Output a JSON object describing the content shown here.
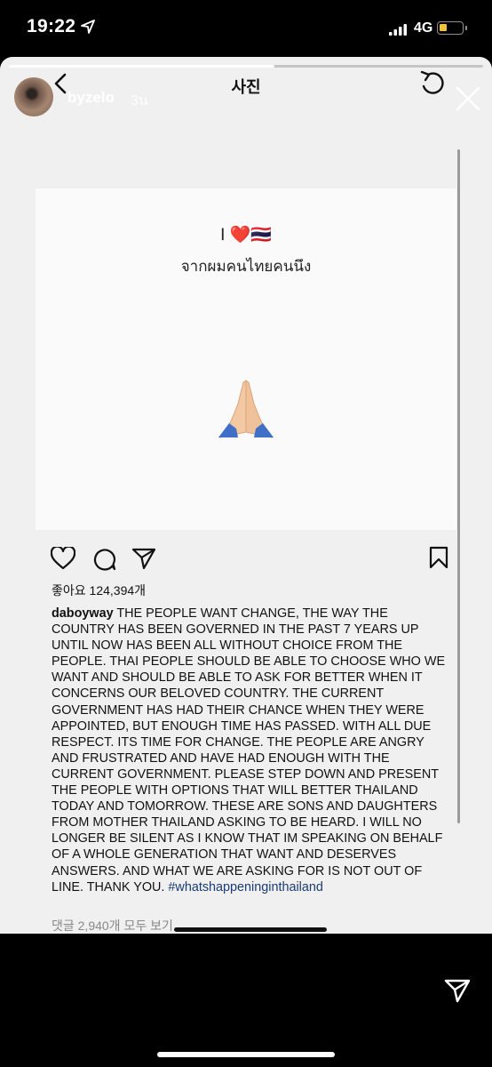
{
  "status_bar": {
    "time": "19:22",
    "network": "4G",
    "battery_level": 0.35,
    "battery_color": "#f4c430"
  },
  "story": {
    "username": "byzelo",
    "time_ago": "3น",
    "progress": 0.56
  },
  "post_header": {
    "title": "사진"
  },
  "post_image": {
    "line1": "I ❤️🇹🇭",
    "line2": "จากผมคนไทยคนนึง",
    "emoji": "🙏🏼"
  },
  "post": {
    "likes": "좋아요 124,394개",
    "caption_user": "daboyway",
    "caption_text": " THE PEOPLE WANT CHANGE,  THE WAY THE COUNTRY HAS BEEN GOVERNED  IN THE PAST 7 YEARS UP UNTIL NOW HAS BEEN ALL WITHOUT CHOICE FROM THE PEOPLE.  THAI PEOPLE SHOULD BE ABLE TO CHOOSE WHO WE WANT AND SHOULD BE ABLE TO ASK FOR BETTER WHEN IT CONCERNS OUR BELOVED COUNTRY.  THE CURRENT GOVERNMENT HAS HAD THEIR CHANCE WHEN THEY WERE APPOINTED, BUT ENOUGH TIME HAS PASSED. WITH ALL DUE RESPECT.  ITS TIME FOR CHANGE. THE PEOPLE ARE ANGRY AND FRUSTRATED AND HAVE HAD ENOUGH WITH THE CURRENT GOVERNMENT.  PLEASE STEP DOWN AND PRESENT THE PEOPLE WITH OPTIONS THAT WILL BETTER THAILAND TODAY AND TOMORROW.  THESE ARE SONS AND DAUGHTERS FROM MOTHER THAILAND ASKING TO BE HEARD.  I WILL NO LONGER BE SILENT AS I KNOW THAT IM SPEAKING ON BEHALF OF A WHOLE GENERATION THAT WANT AND DESERVES ANSWERS.  AND WHAT WE ARE ASKING FOR IS NOT OUT OF LINE.  THANK YOU. ",
    "hashtag": "#whatshappeninginthailand",
    "comments_link": "댓글 2,940개 모두 보기"
  }
}
